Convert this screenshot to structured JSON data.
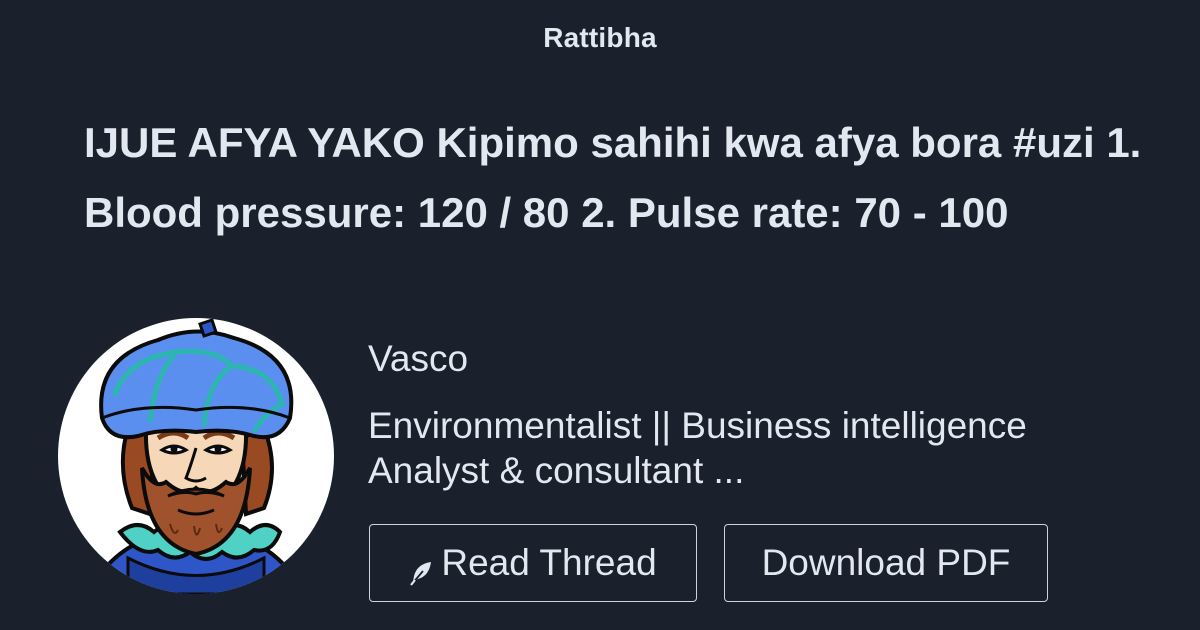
{
  "brand": {
    "name": "Rattibha"
  },
  "thread": {
    "title": "IJUE AFYA YAKO Kipimo sahihi kwa afya bora #uzi 1. Blood pressure: 120 / 80 2. Pulse rate: 70 - 100"
  },
  "author": {
    "name": "Vasco",
    "bio": "Environmentalist || Business intelligence Analyst & consultant ...",
    "avatar_icon": "bearded-man-turban-avatar"
  },
  "actions": {
    "read_label": "Read Thread",
    "read_icon": "feather-icon",
    "pdf_label": "Download PDF"
  },
  "colors": {
    "background": "#1a202c",
    "text": "#e2e8f0",
    "button_border": "#cbd5e0"
  }
}
